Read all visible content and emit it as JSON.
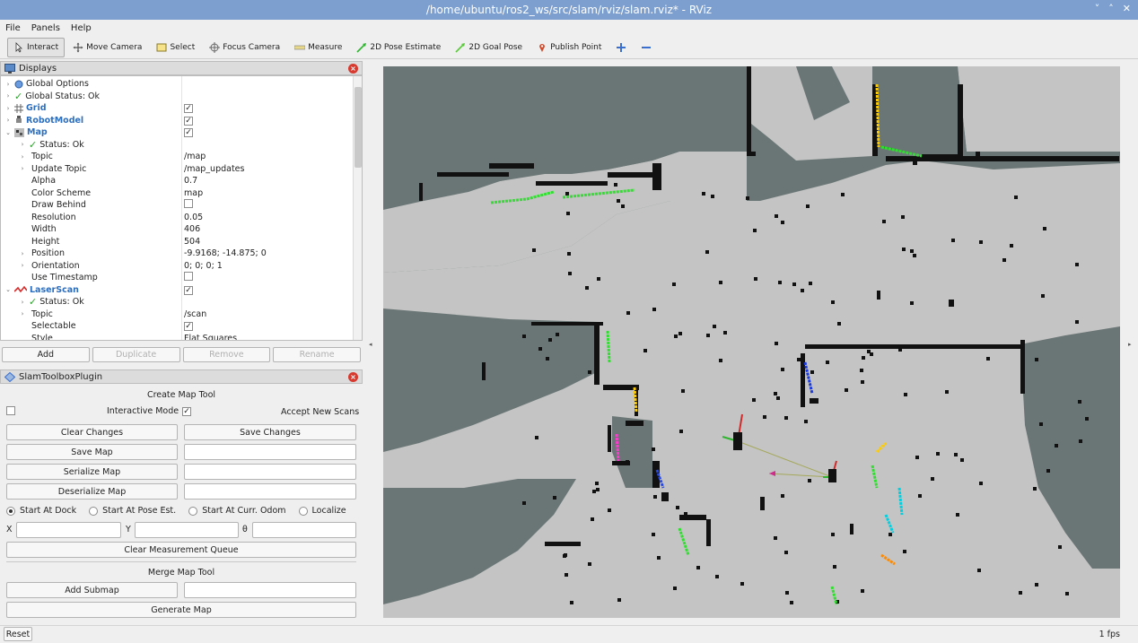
{
  "window": {
    "title": "/home/ubuntu/ros2_ws/src/slam/rviz/slam.rviz* - RViz",
    "controls": [
      "˅",
      "˄",
      "✕"
    ]
  },
  "menu": [
    "File",
    "Panels",
    "Help"
  ],
  "toolbar": [
    {
      "label": "Interact",
      "icon": "cursor-icon",
      "active": true
    },
    {
      "label": "Move Camera",
      "icon": "move-camera-icon"
    },
    {
      "label": "Select",
      "icon": "select-icon"
    },
    {
      "label": "Focus Camera",
      "icon": "focus-camera-icon"
    },
    {
      "label": "Measure",
      "icon": "ruler-icon"
    },
    {
      "label": "2D Pose Estimate",
      "icon": "pose-estimate-arrow-icon"
    },
    {
      "label": "2D Goal Pose",
      "icon": "goal-pose-arrow-icon"
    },
    {
      "label": "Publish Point",
      "icon": "map-pin-icon"
    },
    {
      "label": "",
      "icon": "plus-icon"
    },
    {
      "label": "",
      "icon": "minus-icon"
    }
  ],
  "displays": {
    "title": "Displays",
    "rows": [
      {
        "indent": 0,
        "arrow": "›",
        "icon": "globe-icon",
        "label": "Global Options",
        "value": ""
      },
      {
        "indent": 0,
        "arrow": "›",
        "icon": "check-icon",
        "label": "Global Status: Ok",
        "value": ""
      },
      {
        "indent": 0,
        "arrow": "›",
        "icon": "grid-icon",
        "label": "Grid",
        "bold": true,
        "check": true
      },
      {
        "indent": 0,
        "arrow": "›",
        "icon": "robot-icon",
        "label": "RobotModel",
        "bold": true,
        "check": true
      },
      {
        "indent": 0,
        "arrow": "⌄",
        "icon": "map-icon",
        "label": "Map",
        "bold": true,
        "check": true
      },
      {
        "indent": 1,
        "arrow": "›",
        "icon": "check-icon",
        "label": "Status: Ok",
        "value": ""
      },
      {
        "indent": 1,
        "arrow": "›",
        "label": "Topic",
        "value": "/map"
      },
      {
        "indent": 1,
        "arrow": "›",
        "label": "Update Topic",
        "value": "/map_updates"
      },
      {
        "indent": 1,
        "label": "Alpha",
        "value": "0.7"
      },
      {
        "indent": 1,
        "label": "Color Scheme",
        "value": "map"
      },
      {
        "indent": 1,
        "label": "Draw Behind",
        "check": false
      },
      {
        "indent": 1,
        "label": "Resolution",
        "value": "0.05"
      },
      {
        "indent": 1,
        "label": "Width",
        "value": "406"
      },
      {
        "indent": 1,
        "label": "Height",
        "value": "504"
      },
      {
        "indent": 1,
        "arrow": "›",
        "label": "Position",
        "value": "-9.9168; -14.875; 0"
      },
      {
        "indent": 1,
        "arrow": "›",
        "label": "Orientation",
        "value": "0; 0; 0; 1"
      },
      {
        "indent": 1,
        "label": "Use Timestamp",
        "check": false
      },
      {
        "indent": 0,
        "arrow": "⌄",
        "icon": "laserscan-icon",
        "label": "LaserScan",
        "bold": true,
        "check": true
      },
      {
        "indent": 1,
        "arrow": "›",
        "icon": "check-icon",
        "label": "Status: Ok",
        "value": ""
      },
      {
        "indent": 1,
        "arrow": "›",
        "label": "Topic",
        "value": "/scan"
      },
      {
        "indent": 1,
        "label": "Selectable",
        "check": true
      },
      {
        "indent": 1,
        "label": "Style",
        "value": "Flat Squares"
      }
    ],
    "buttons": [
      {
        "label": "Add",
        "enabled": true
      },
      {
        "label": "Duplicate",
        "enabled": false
      },
      {
        "label": "Remove",
        "enabled": false
      },
      {
        "label": "Rename",
        "enabled": false
      }
    ]
  },
  "slam": {
    "title": "SlamToolboxPlugin",
    "create_map_tool": "Create Map Tool",
    "interactive_mode": "Interactive Mode",
    "accept_new_scans": "Accept New Scans",
    "clear_changes": "Clear Changes",
    "save_changes": "Save Changes",
    "save_map": "Save Map",
    "serialize_map": "Serialize Map",
    "deserialize_map": "Deserialize Map",
    "radios": [
      "Start At Dock",
      "Start At Pose Est.",
      "Start At Curr. Odom",
      "Localize"
    ],
    "x_label": "X",
    "y_label": "Y",
    "theta_label": "θ",
    "clear_measurement": "Clear Measurement Queue",
    "merge_map_tool": "Merge Map Tool",
    "add_submap": "Add Submap",
    "generate_map": "Generate Map"
  },
  "status": {
    "reset": "Reset",
    "fps": "1 fps"
  },
  "colors": {
    "title_bar": "#7c9fcf",
    "map_unknown": "#6a7675",
    "map_free": "#c4c4c4",
    "map_occupied": "#111111",
    "accent_blue": "#2d6fbf"
  }
}
